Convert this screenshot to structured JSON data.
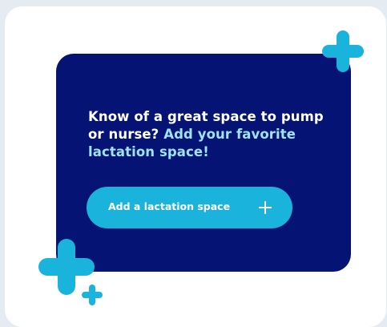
{
  "card": {
    "prompt_line": "Know of a great space to pump or nurse?",
    "prompt_accent": "Add your favorite lactation space!",
    "button_label": "Add a lactation space",
    "button_icon": "plus-icon"
  },
  "colors": {
    "background": "#e4ebf3",
    "card": "#051374",
    "accent_text": "#9fe3f6",
    "button": "#1ab3dc",
    "sparkle": "#1ab3dc"
  },
  "decorations": {
    "icons": [
      "sparkle-plus-icon",
      "sparkle-plus-icon",
      "sparkle-plus-icon"
    ]
  }
}
